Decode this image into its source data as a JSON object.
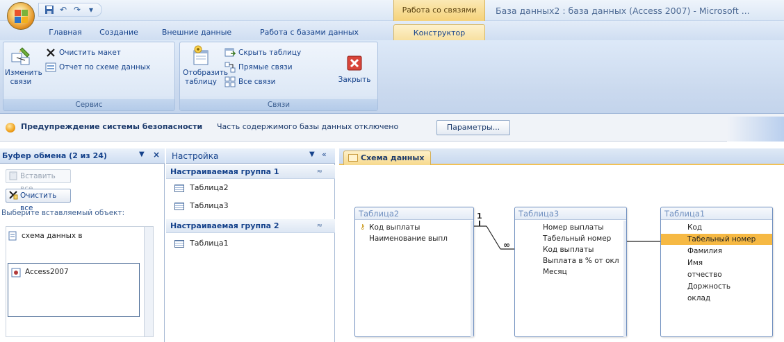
{
  "titlebar": {
    "context_tab": "Работа со связями",
    "window_title": "База данных2 : база данных (Access 2007) - Microsoft ..."
  },
  "qat": {
    "icons": [
      "save-icon",
      "undo-icon",
      "redo-icon",
      "dropdown-icon"
    ],
    "undo": "↶",
    "redo": "↷",
    "more": "▾"
  },
  "tabs": [
    "Главная",
    "Создание",
    "Внешние данные",
    "Работа с базами данных",
    "Конструктор"
  ],
  "ribbon": {
    "group_service": {
      "label": "Сервис",
      "edit_links": "Изменить\nсвязи",
      "clear_layout": "Очистить макет",
      "schema_report": "Отчет по схеме данных"
    },
    "group_links": {
      "label": "Связи",
      "show_table": "Отобразить\nтаблицу",
      "hide_table": "Скрыть таблицу",
      "direct_links": "Прямые связи",
      "all_links": "Все связи",
      "close": "Закрыть"
    }
  },
  "security_bar": {
    "title": "Предупреждение системы безопасности",
    "message": "Часть содержимого базы данных отключено",
    "button": "Параметры..."
  },
  "clipboard": {
    "title": "Буфер обмена (2 из 24)",
    "menu": "▼",
    "close": "×",
    "paste_all": "Вставить все",
    "clear_all": "Очистить все",
    "prompt": "Выберите вставляемый объект:",
    "items": [
      "схема данных в",
      "Access2007"
    ]
  },
  "nav": {
    "title": "Настройка",
    "menu": "▼",
    "collapse": "«",
    "groups": [
      {
        "name": "Настраиваемая группа 1",
        "chevron": "≈",
        "items": [
          "Таблица2",
          "Таблица3"
        ]
      },
      {
        "name": "Настраиваемая группа 2",
        "chevron": "≈",
        "items": [
          "Таблица1"
        ]
      }
    ]
  },
  "document": {
    "tab": "Схема данных",
    "tables": [
      {
        "title": "Таблица2",
        "fields": [
          "Код выплаты",
          "Наименование выпл"
        ],
        "key_field": "Код выплаты"
      },
      {
        "title": "Таблица3",
        "fields": [
          "Номер выплаты",
          "Табельный номер",
          "Код выплаты",
          "Выплата в % от окл",
          "Месяц"
        ]
      },
      {
        "title": "Таблица1",
        "fields": [
          "Код",
          "Табельный номер",
          "Фамилия",
          "Имя",
          "отчество",
          "Доржность",
          "оклад"
        ],
        "selected": "Табельный номер"
      }
    ],
    "relation_one": "1",
    "relation_many": "∞"
  },
  "colors": {
    "accent_orange": "#f6b944",
    "ribbon_blue": "#dde9f8",
    "text_blue": "#15428b"
  }
}
